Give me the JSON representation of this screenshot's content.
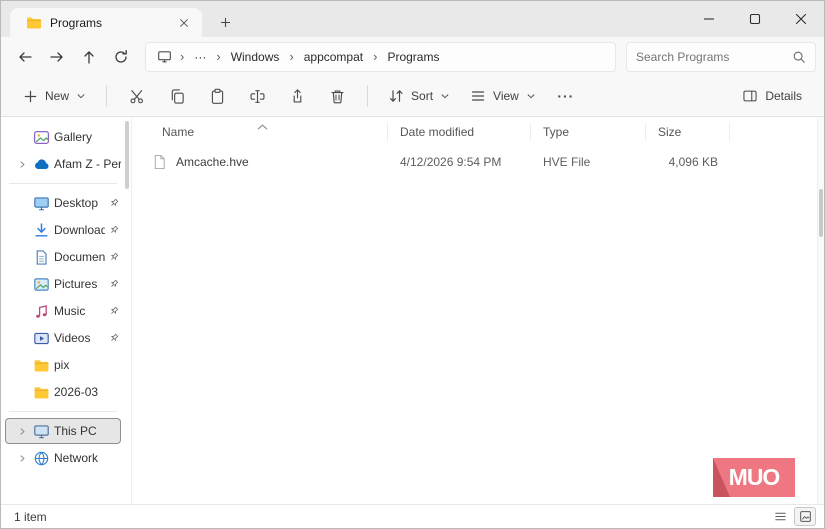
{
  "window": {
    "tab_title": "Programs"
  },
  "nav": {
    "breadcrumb": {
      "separator": "›",
      "overflow": "···",
      "items": [
        "Windows",
        "appcompat",
        "Programs"
      ]
    },
    "search_placeholder": "Search Programs"
  },
  "toolbar": {
    "new_label": "New",
    "sort_label": "Sort",
    "view_label": "View",
    "more_label": "···",
    "details_label": "Details"
  },
  "sidebar": {
    "items": [
      {
        "label": "Gallery",
        "pinned": false
      },
      {
        "label": "Afam Z - Person",
        "pinned": false
      },
      {
        "label": "Desktop",
        "pinned": true
      },
      {
        "label": "Downloads",
        "pinned": true
      },
      {
        "label": "Documents",
        "pinned": true
      },
      {
        "label": "Pictures",
        "pinned": true
      },
      {
        "label": "Music",
        "pinned": true
      },
      {
        "label": "Videos",
        "pinned": true
      },
      {
        "label": "pix",
        "pinned": false
      },
      {
        "label": "2026-03",
        "pinned": false
      },
      {
        "label": "This PC",
        "pinned": false
      },
      {
        "label": "Network",
        "pinned": false
      }
    ]
  },
  "files": {
    "columns": {
      "name": "Name",
      "date_modified": "Date modified",
      "type": "Type",
      "size": "Size"
    },
    "rows": [
      {
        "name": "Amcache.hve",
        "date_modified": "4/12/2026 9:54 PM",
        "type": "HVE File",
        "size": "4,096 KB"
      }
    ]
  },
  "statusbar": {
    "count": "1 item"
  },
  "watermark": {
    "text": "MUO"
  },
  "colors": {
    "watermark_pink": "#ee7781",
    "watermark_dark": "#c9545f",
    "folder_yellow": "#fdc936",
    "onedrive_blue": "#0e6fc1"
  }
}
